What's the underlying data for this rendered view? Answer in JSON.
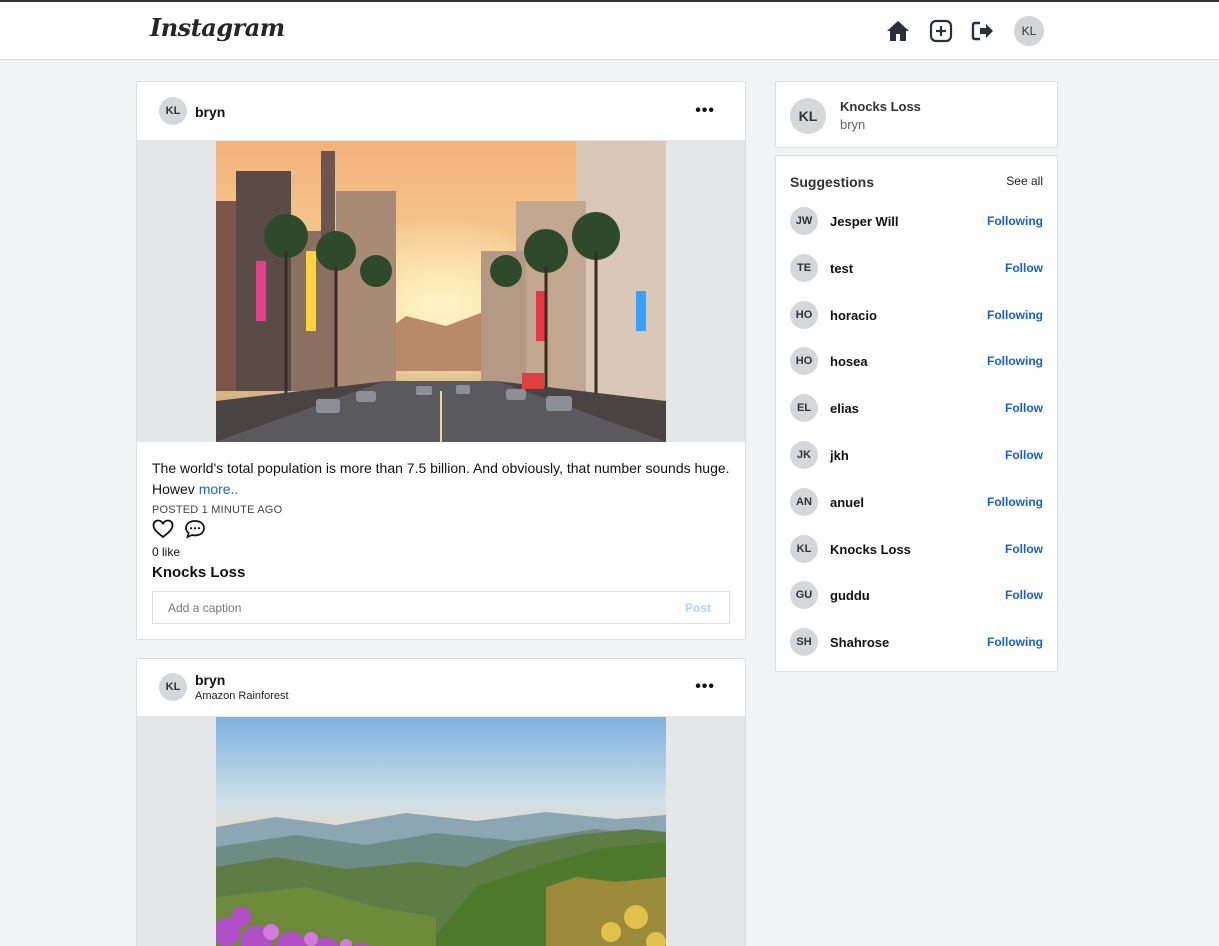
{
  "header": {
    "logo": "Instagram",
    "icons": [
      "home-icon",
      "add-post-icon",
      "logout-icon"
    ],
    "avatar_initials": "KL"
  },
  "posts": [
    {
      "initials": "KL",
      "username": "bryn",
      "location": "",
      "caption": "The world's total population is more than 7.5 billion. And obviously, that number sounds huge. Howev ",
      "more_label": "more..",
      "posted": "POSTED 1 MINUTE AGO",
      "likes": "0 like",
      "owner": "Knocks Loss",
      "comment_placeholder": "Add a caption",
      "post_label": "Post"
    },
    {
      "initials": "KL",
      "username": "bryn",
      "location": "Amazon Rainforest"
    }
  ],
  "profile": {
    "initials": "KL",
    "name": "Knocks Loss",
    "username": "bryn"
  },
  "suggestions": {
    "title": "Suggestions",
    "see_all": "See all",
    "items": [
      {
        "initials": "JW",
        "name": "Jesper Will",
        "action": "Following"
      },
      {
        "initials": "TE",
        "name": "test",
        "action": "Follow"
      },
      {
        "initials": "HO",
        "name": "horacio",
        "action": "Following"
      },
      {
        "initials": "HO",
        "name": "hosea",
        "action": "Following"
      },
      {
        "initials": "EL",
        "name": "elias",
        "action": "Follow"
      },
      {
        "initials": "JK",
        "name": "jkh",
        "action": "Follow"
      },
      {
        "initials": "AN",
        "name": "anuel",
        "action": "Following"
      },
      {
        "initials": "KL",
        "name": "Knocks Loss",
        "action": "Follow"
      },
      {
        "initials": "GU",
        "name": "guddu",
        "action": "Follow"
      },
      {
        "initials": "SH",
        "name": "Shahrose",
        "action": "Following"
      }
    ]
  },
  "colors": {
    "link": "#1565d8",
    "follow": "#1560d4",
    "post_disabled": "#b3d1f2",
    "background": "#f2f3f5"
  }
}
